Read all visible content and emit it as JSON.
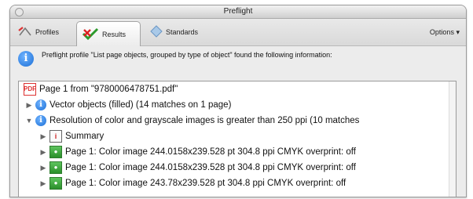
{
  "window": {
    "title": "Preflight"
  },
  "toolbar": {
    "tabs": [
      {
        "label": "Profiles",
        "icon": "profiles-icon"
      },
      {
        "label": "Results",
        "icon": "results-icon"
      },
      {
        "label": "Standards",
        "icon": "standards-icon"
      }
    ],
    "options_label": "Options"
  },
  "message": {
    "text": "Preflight profile \"List page objects, grouped by type of object\" found the following information:"
  },
  "tree": {
    "rows": [
      {
        "text": "Page 1 from \"9780006478751.pdf\"",
        "icon": "pdf-icon"
      },
      {
        "text": "Vector objects (filled) (14 matches on 1 page)",
        "icon": "info-icon",
        "expander": "▶"
      },
      {
        "text": "Resolution of color and grayscale images is greater than 250 ppi (10 matches",
        "icon": "info-icon",
        "expander": "▼"
      },
      {
        "text": "Summary",
        "icon": "summary-icon",
        "expander": "▶"
      },
      {
        "text": "Page 1: Color image 244.0158x239.528 pt 304.8 ppi CMYK  overprint: off",
        "icon": "image-icon",
        "expander": "▶"
      },
      {
        "text": "Page 1: Color image 244.0158x239.528 pt 304.8 ppi CMYK  overprint: off",
        "icon": "image-icon",
        "expander": "▶"
      },
      {
        "text": "Page 1: Color image 243.78x239.528 pt 304.8 ppi CMYK  overprint: off",
        "icon": "image-icon",
        "expander": "▶"
      }
    ]
  }
}
